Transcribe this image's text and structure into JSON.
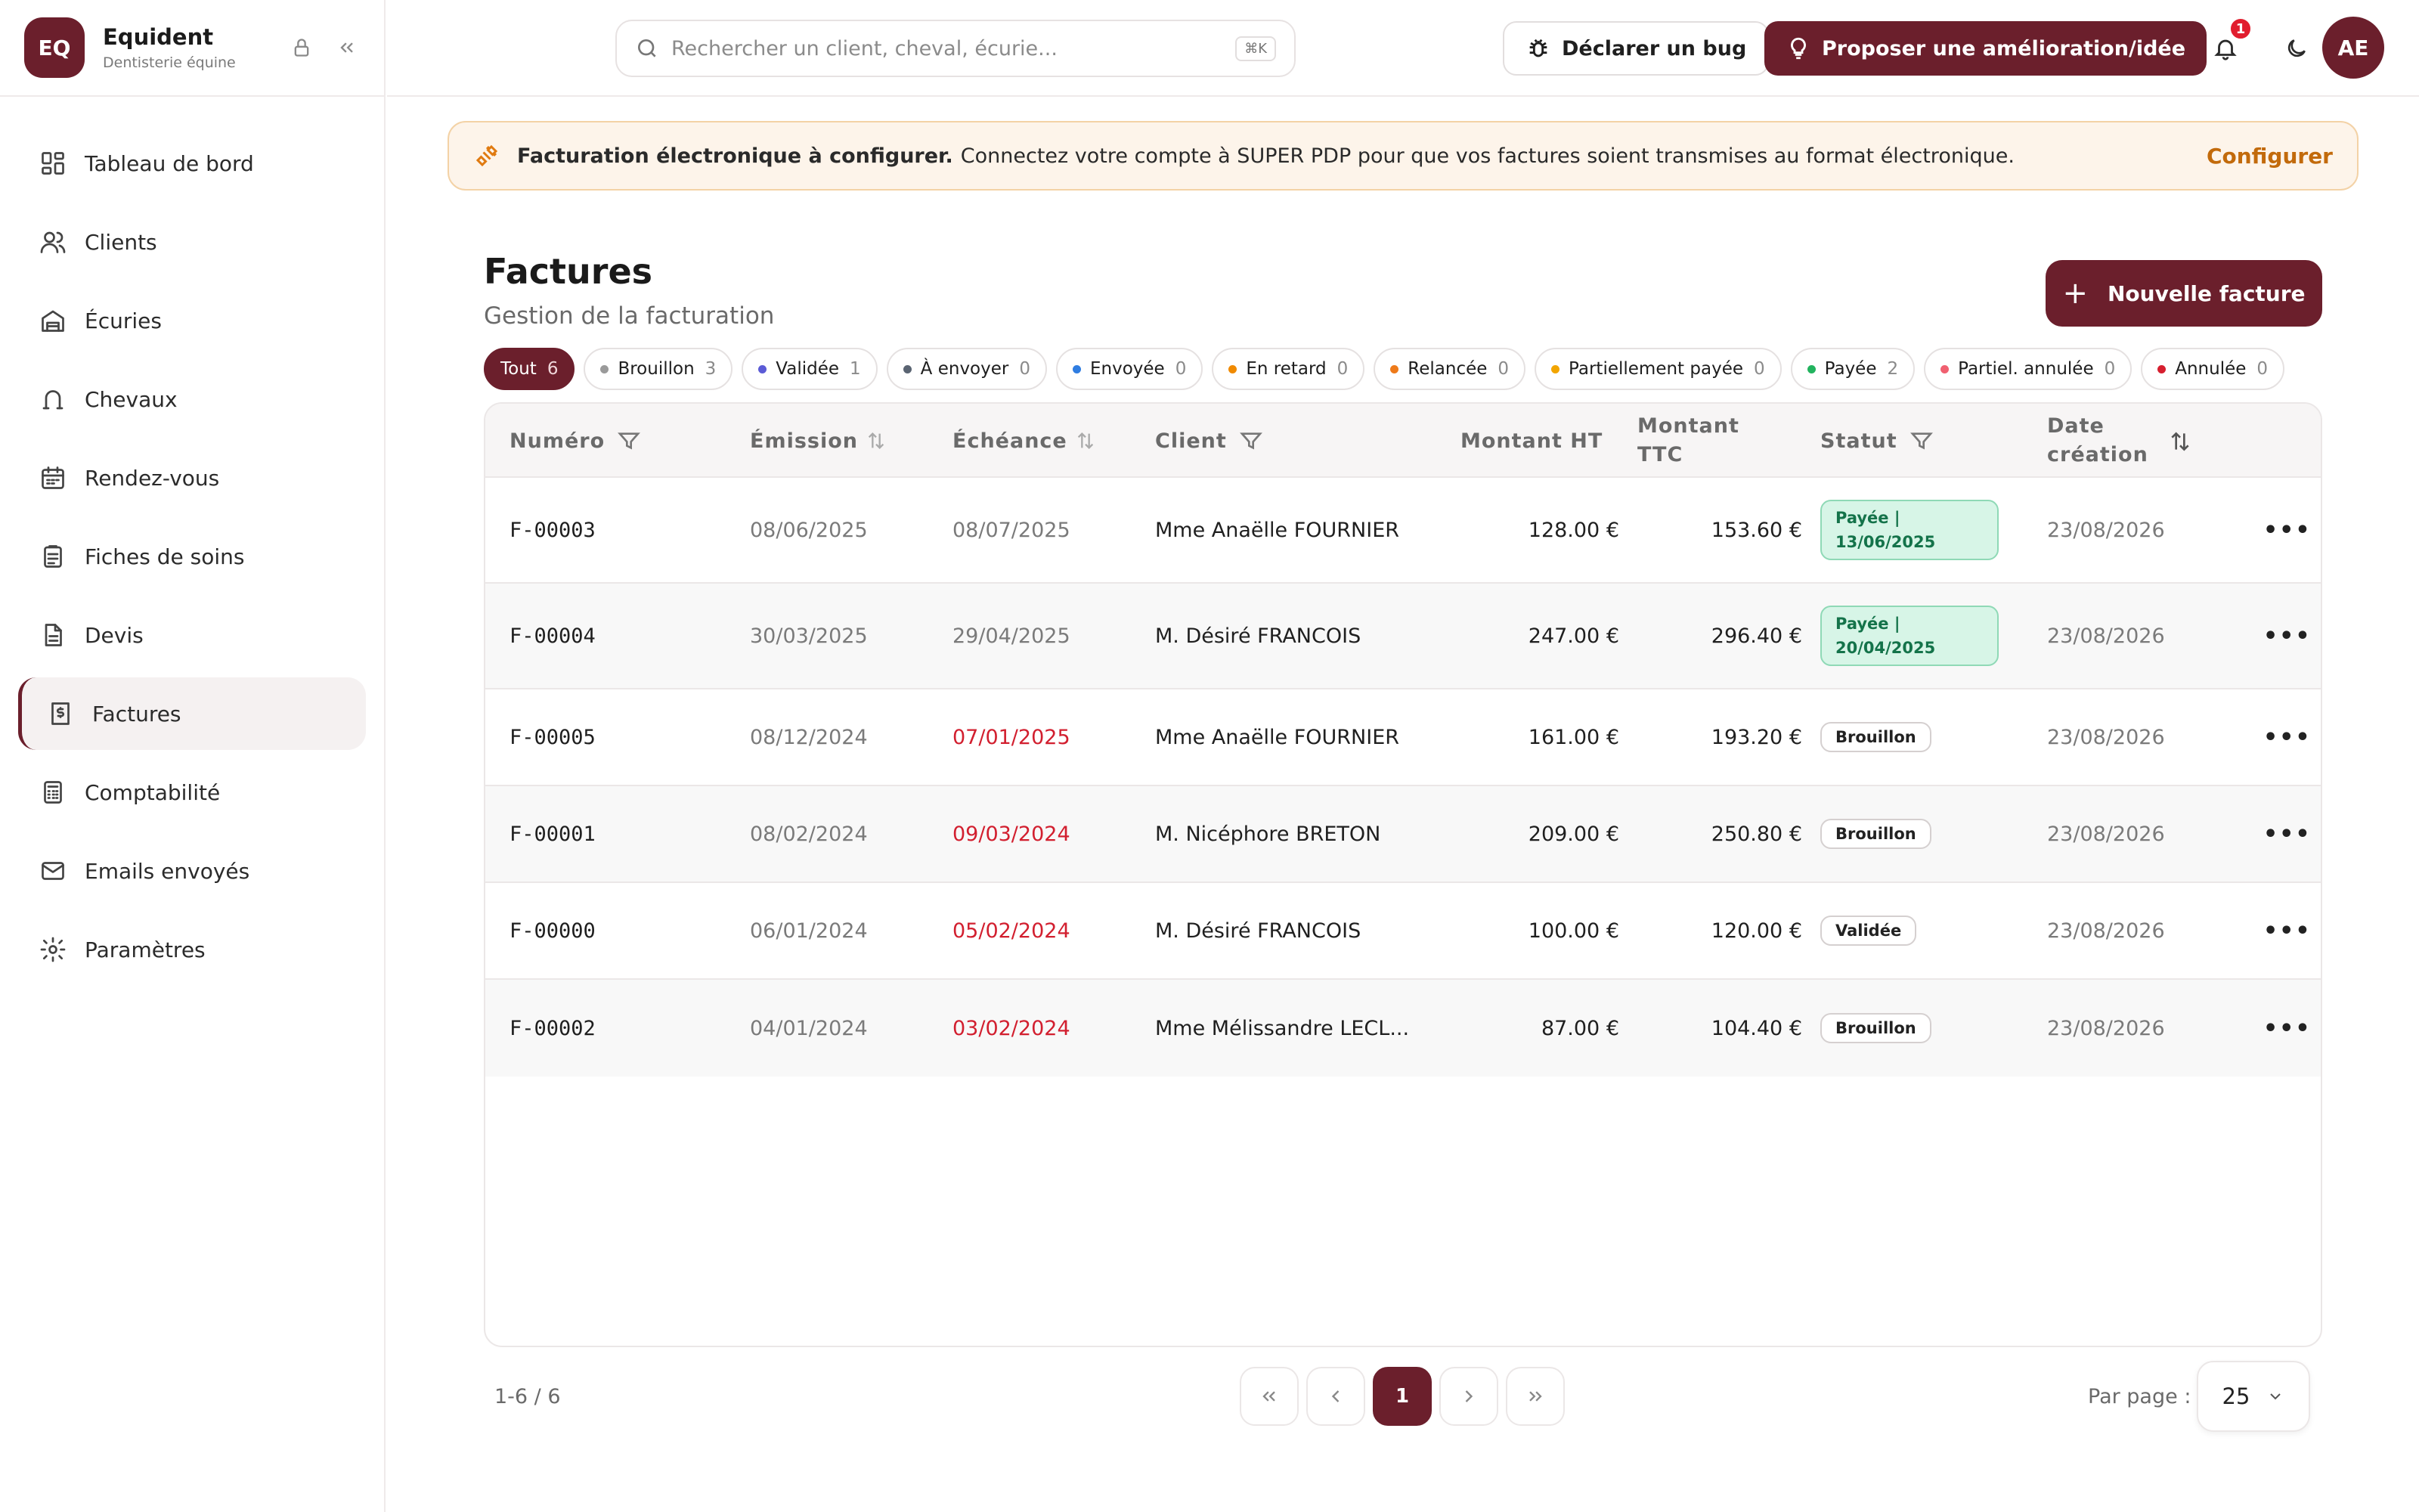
{
  "app": {
    "logo_initials": "EQ",
    "name": "Equident",
    "subtitle": "Dentisterie équine"
  },
  "sidebar": {
    "items": [
      {
        "label": "Tableau de bord",
        "icon": "dashboard-icon",
        "active": false
      },
      {
        "label": "Clients",
        "icon": "users-icon",
        "active": false
      },
      {
        "label": "Écuries",
        "icon": "stable-icon",
        "active": false
      },
      {
        "label": "Chevaux",
        "icon": "horseshoe-icon",
        "active": false
      },
      {
        "label": "Rendez-vous",
        "icon": "calendar-icon",
        "active": false
      },
      {
        "label": "Fiches de soins",
        "icon": "clipboard-icon",
        "active": false
      },
      {
        "label": "Devis",
        "icon": "document-icon",
        "active": false
      },
      {
        "label": "Factures",
        "icon": "invoice-icon",
        "active": true
      },
      {
        "label": "Comptabilité",
        "icon": "calculator-icon",
        "active": false
      },
      {
        "label": "Emails envoyés",
        "icon": "mail-icon",
        "active": false
      },
      {
        "label": "Paramètres",
        "icon": "gear-icon",
        "active": false
      }
    ]
  },
  "topbar": {
    "search_placeholder": "Rechercher un client, cheval, écurie...",
    "search_shortcut": "⌘K",
    "bug_label": "Déclarer un bug",
    "idea_label": "Proposer une amélioration/idée",
    "notification_count": "1",
    "user_initials": "AE"
  },
  "banner": {
    "title": "Facturation électronique à configurer.",
    "text": "Connectez votre compte à SUPER PDP pour que vos factures soient transmises au format électronique.",
    "action": "Configurer"
  },
  "page": {
    "title": "Factures",
    "subtitle": "Gestion de la facturation",
    "new_button": "Nouvelle facture"
  },
  "filters": [
    {
      "label": "Tout",
      "count": "6",
      "color": "",
      "active": true
    },
    {
      "label": "Brouillon",
      "count": "3",
      "color": "#9a9a9a",
      "active": false
    },
    {
      "label": "Validée",
      "count": "1",
      "color": "#5b5bd6",
      "active": false
    },
    {
      "label": "À envoyer",
      "count": "0",
      "color": "#5a6472",
      "active": false
    },
    {
      "label": "Envoyée",
      "count": "0",
      "color": "#2f7de1",
      "active": false
    },
    {
      "label": "En retard",
      "count": "0",
      "color": "#f08a00",
      "active": false
    },
    {
      "label": "Relancée",
      "count": "0",
      "color": "#ee7a1a",
      "active": false
    },
    {
      "label": "Partiellement payée",
      "count": "0",
      "color": "#f2a500",
      "active": false
    },
    {
      "label": "Payée",
      "count": "2",
      "color": "#22b35e",
      "active": false
    },
    {
      "label": "Partiel. annulée",
      "count": "0",
      "color": "#f06070",
      "active": false
    },
    {
      "label": "Annulée",
      "count": "0",
      "color": "#d61f2f",
      "active": false
    }
  ],
  "table": {
    "headers": {
      "numero": "Numéro",
      "emission": "Émission",
      "echeance": "Échéance",
      "client": "Client",
      "montant_ht": "Montant HT",
      "montant_ttc_1": "Montant",
      "montant_ttc_2": "TTC",
      "statut": "Statut",
      "date_1": "Date",
      "date_2": "création"
    },
    "rows": [
      {
        "numero": "F-00003",
        "emission": "08/06/2025",
        "echeance": "08/07/2025",
        "overdue": false,
        "client": "Mme Anaëlle FOURNIER",
        "ht": "128.00 €",
        "ttc": "153.60 €",
        "status_1": "Payée |",
        "status_2": "13/06/2025",
        "paid": true,
        "created": "23/08/2026"
      },
      {
        "numero": "F-00004",
        "emission": "30/03/2025",
        "echeance": "29/04/2025",
        "overdue": false,
        "client": "M. Désiré FRANCOIS",
        "ht": "247.00 €",
        "ttc": "296.40 €",
        "status_1": "Payée |",
        "status_2": "20/04/2025",
        "paid": true,
        "created": "23/08/2026"
      },
      {
        "numero": "F-00005",
        "emission": "08/12/2024",
        "echeance": "07/01/2025",
        "overdue": true,
        "client": "Mme Anaëlle FOURNIER",
        "ht": "161.00 €",
        "ttc": "193.20 €",
        "status_1": "Brouillon",
        "status_2": "",
        "paid": false,
        "created": "23/08/2026"
      },
      {
        "numero": "F-00001",
        "emission": "08/02/2024",
        "echeance": "09/03/2024",
        "overdue": true,
        "client": "M. Nicéphore BRETON",
        "ht": "209.00 €",
        "ttc": "250.80 €",
        "status_1": "Brouillon",
        "status_2": "",
        "paid": false,
        "created": "23/08/2026"
      },
      {
        "numero": "F-00000",
        "emission": "06/01/2024",
        "echeance": "05/02/2024",
        "overdue": true,
        "client": "M. Désiré FRANCOIS",
        "ht": "100.00 €",
        "ttc": "120.00 €",
        "status_1": "Validée",
        "status_2": "",
        "paid": false,
        "created": "23/08/2026"
      },
      {
        "numero": "F-00002",
        "emission": "04/01/2024",
        "echeance": "03/02/2024",
        "overdue": true,
        "client": "Mme Mélissandre LECL...",
        "ht": "87.00 €",
        "ttc": "104.40 €",
        "status_1": "Brouillon",
        "status_2": "",
        "paid": false,
        "created": "23/08/2026"
      }
    ]
  },
  "pagination": {
    "info": "1-6 / 6",
    "current_page": "1",
    "per_page_label": "Par page :",
    "per_page": "25"
  }
}
